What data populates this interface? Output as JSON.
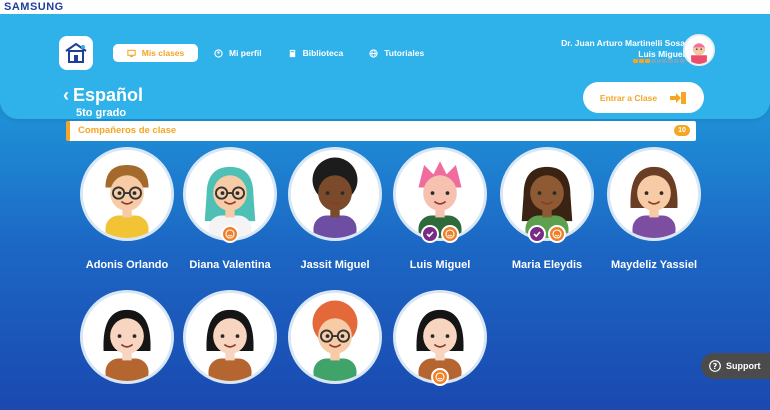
{
  "brand": "SAMSUNG",
  "nav": {
    "items": [
      {
        "label": "Mis clases",
        "icon": "monitor-icon",
        "active": true
      },
      {
        "label": "Mi perfil",
        "icon": "profile-icon",
        "active": false
      },
      {
        "label": "Biblioteca",
        "icon": "book-icon",
        "active": false
      },
      {
        "label": "Tutoriales",
        "icon": "globe-icon",
        "active": false
      }
    ]
  },
  "user": {
    "name": "Dr. Juan Arturo Martinelli Sosa",
    "student": "Luis Miguel",
    "progress_segments_total": 9,
    "progress_segments_filled": 3
  },
  "page": {
    "title": "Español",
    "subtitle": "5to grado",
    "enter_label": "Entrar a Clase"
  },
  "section": {
    "title": "Compañeros de clase",
    "count": "10"
  },
  "students": [
    {
      "name": "Adonis Orlando",
      "badges": []
    },
    {
      "name": "Diana Valentina",
      "badges": [
        "orange"
      ]
    },
    {
      "name": "Jassit Miguel",
      "badges": []
    },
    {
      "name": "Luis Miguel",
      "badges": [
        "purple",
        "orange"
      ]
    },
    {
      "name": "Maria Eleydis",
      "badges": [
        "purple",
        "orange"
      ]
    },
    {
      "name": "Maydeliz Yassiel",
      "badges": []
    },
    {
      "name": "",
      "badges": []
    },
    {
      "name": "",
      "badges": []
    },
    {
      "name": "",
      "badges": []
    },
    {
      "name": "",
      "badges": [
        "orange"
      ]
    }
  ],
  "support": {
    "label": "Support"
  },
  "colors": {
    "accent": "#f5a623",
    "header": "#2fb2ea",
    "badge_purple": "#7b2b86",
    "badge_orange": "#f07f2a"
  }
}
